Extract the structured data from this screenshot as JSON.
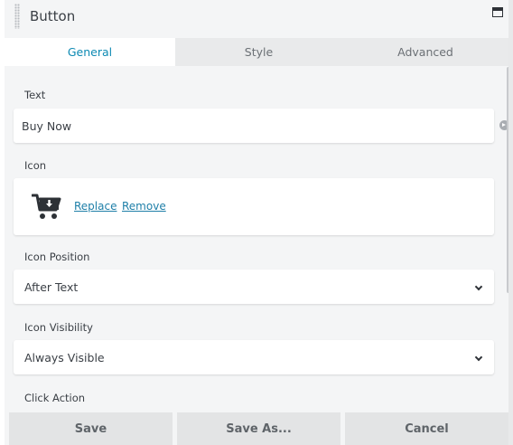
{
  "header": {
    "title": "Button"
  },
  "tabs": [
    {
      "label": "General",
      "active": true
    },
    {
      "label": "Style",
      "active": false
    },
    {
      "label": "Advanced",
      "active": false
    }
  ],
  "fields": {
    "text": {
      "label": "Text",
      "value": "Buy Now"
    },
    "icon": {
      "label": "Icon",
      "icon_name": "cart-download-icon",
      "replace_label": "Replace",
      "remove_label": "Remove"
    },
    "icon_position": {
      "label": "Icon Position",
      "value": "After Text"
    },
    "icon_visibility": {
      "label": "Icon Visibility",
      "value": "Always Visible"
    },
    "click_action": {
      "label": "Click Action"
    }
  },
  "footer": {
    "save_label": "Save",
    "save_as_label": "Save As...",
    "cancel_label": "Cancel"
  },
  "colors": {
    "accent": "#0e8ab3",
    "link": "#1e7fa8",
    "panel_bg": "#f4f5f6"
  }
}
